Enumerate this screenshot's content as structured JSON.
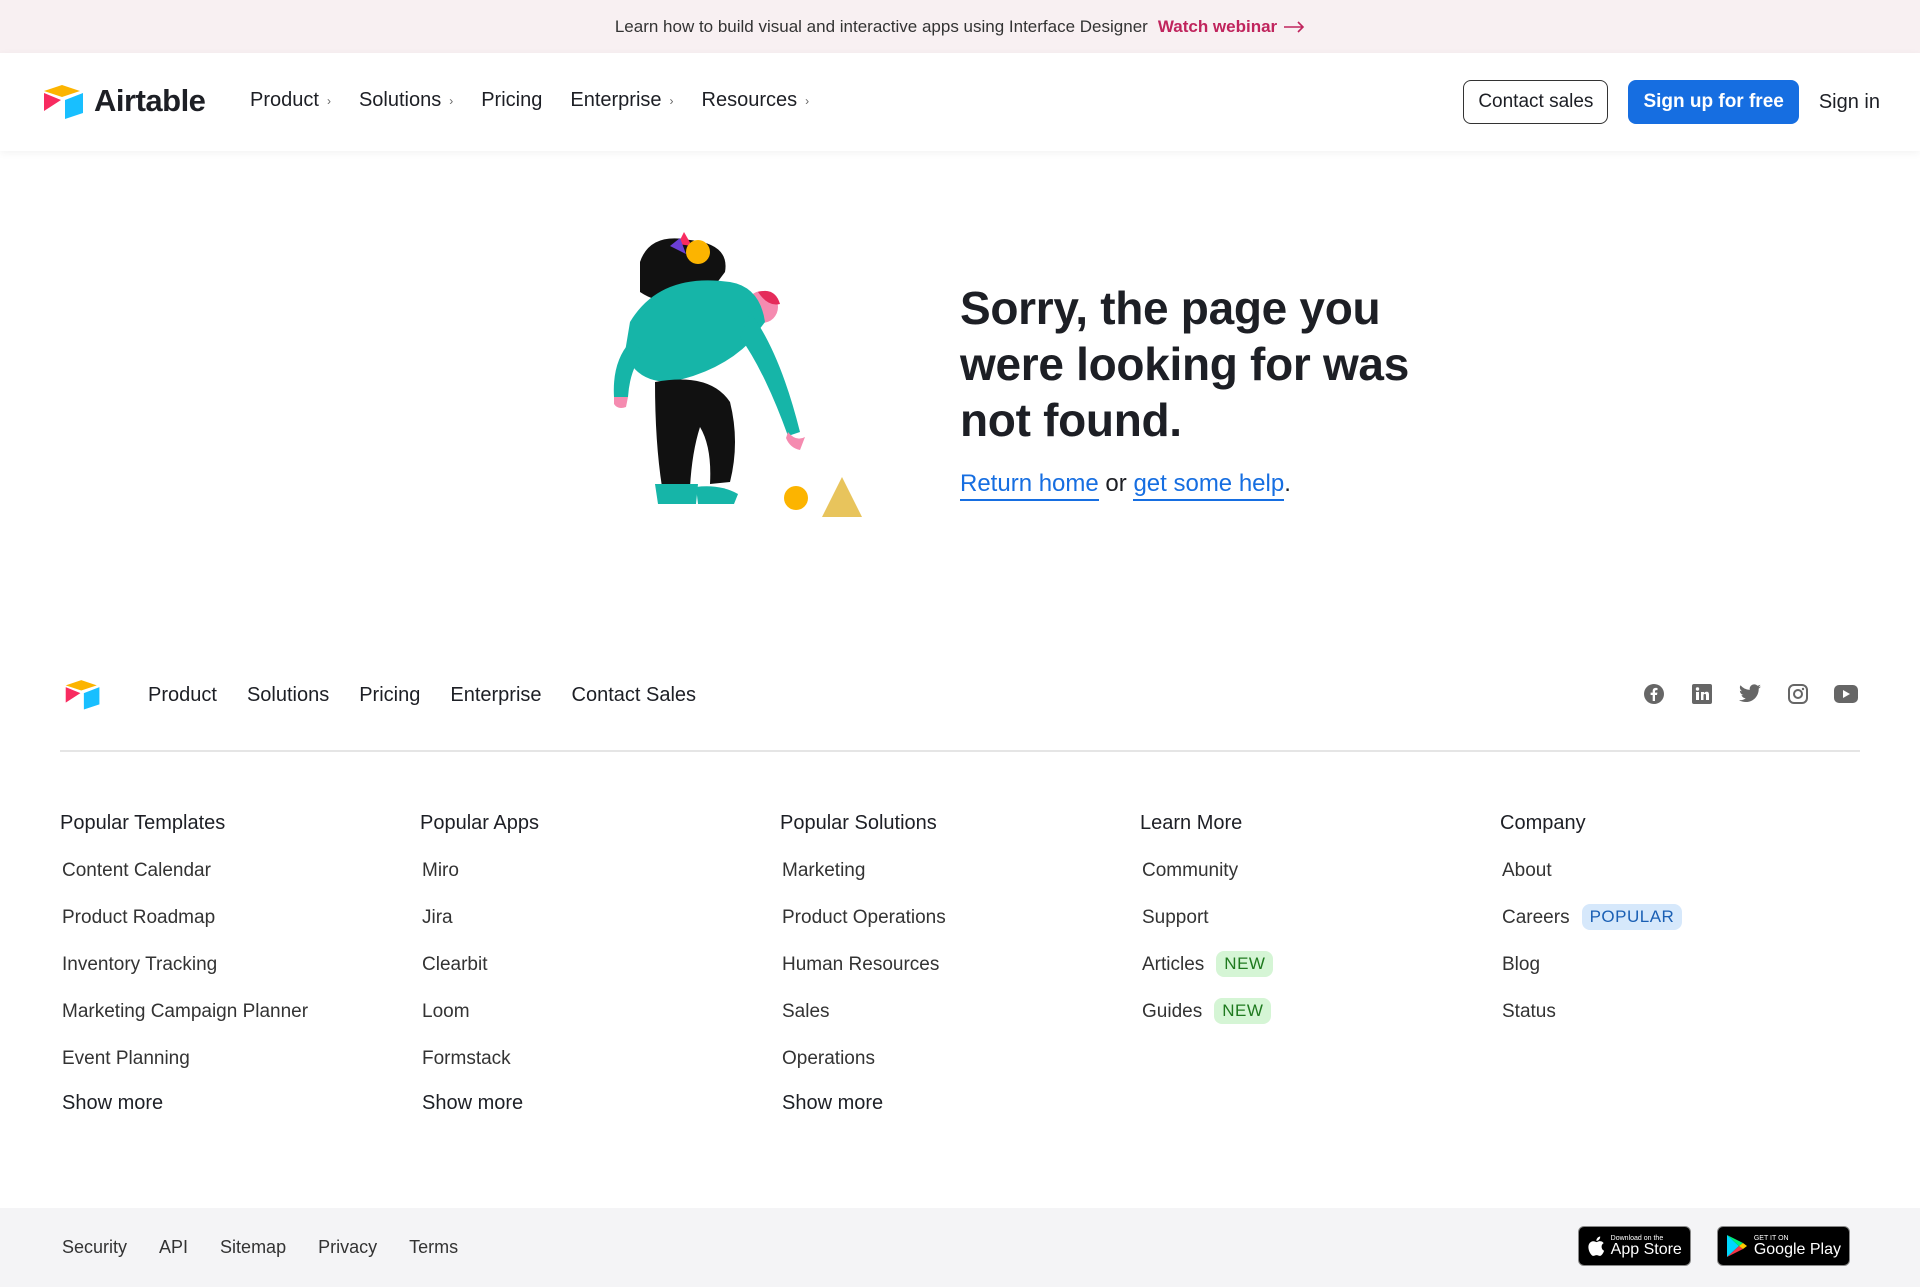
{
  "announcement": {
    "text": "Learn how to build visual and interactive apps using Interface Designer",
    "link_label": "Watch webinar"
  },
  "header": {
    "brand": "Airtable",
    "nav": [
      {
        "label": "Product",
        "has_chevron": true
      },
      {
        "label": "Solutions",
        "has_chevron": true
      },
      {
        "label": "Pricing",
        "has_chevron": false
      },
      {
        "label": "Enterprise",
        "has_chevron": true
      },
      {
        "label": "Resources",
        "has_chevron": true
      }
    ],
    "contact_sales": "Contact sales",
    "signup": "Sign up for free",
    "signin": "Sign in"
  },
  "not_found": {
    "heading": "Sorry, the page you were looking for was not found.",
    "return_home": "Return home",
    "or": "or",
    "get_help": "get some help",
    "period": "."
  },
  "footer": {
    "nav": [
      "Product",
      "Solutions",
      "Pricing",
      "Enterprise",
      "Contact Sales"
    ],
    "social": [
      "facebook-icon",
      "linkedin-icon",
      "twitter-icon",
      "instagram-icon",
      "youtube-icon"
    ],
    "columns": [
      {
        "title": "Popular Templates",
        "items": [
          {
            "label": "Content Calendar"
          },
          {
            "label": "Product Roadmap"
          },
          {
            "label": "Inventory Tracking"
          },
          {
            "label": "Marketing Campaign Planner"
          },
          {
            "label": "Event Planning"
          }
        ],
        "more": "Show more"
      },
      {
        "title": "Popular Apps",
        "items": [
          {
            "label": "Miro"
          },
          {
            "label": "Jira"
          },
          {
            "label": "Clearbit"
          },
          {
            "label": "Loom"
          },
          {
            "label": "Formstack"
          }
        ],
        "more": "Show more"
      },
      {
        "title": "Popular Solutions",
        "items": [
          {
            "label": "Marketing"
          },
          {
            "label": "Product Operations"
          },
          {
            "label": "Human Resources"
          },
          {
            "label": "Sales"
          },
          {
            "label": "Operations"
          }
        ],
        "more": "Show more"
      },
      {
        "title": "Learn More",
        "items": [
          {
            "label": "Community"
          },
          {
            "label": "Support"
          },
          {
            "label": "Articles",
            "badge": "NEW"
          },
          {
            "label": "Guides",
            "badge": "NEW"
          }
        ]
      },
      {
        "title": "Company",
        "items": [
          {
            "label": "About"
          },
          {
            "label": "Careers",
            "badge": "POPULAR"
          },
          {
            "label": "Blog"
          },
          {
            "label": "Status"
          }
        ]
      }
    ],
    "bottom_links": [
      "Security",
      "API",
      "Sitemap",
      "Privacy",
      "Terms"
    ],
    "stores": [
      {
        "small": "Download on the",
        "big": "App Store",
        "icon": "apple-icon"
      },
      {
        "small": "GET IT ON",
        "big": "Google Play",
        "icon": "google-play-icon"
      }
    ]
  },
  "colors": {
    "accent": "#166ee1",
    "announce_link": "#c0245d",
    "announce_bg": "#f8f0f2"
  }
}
